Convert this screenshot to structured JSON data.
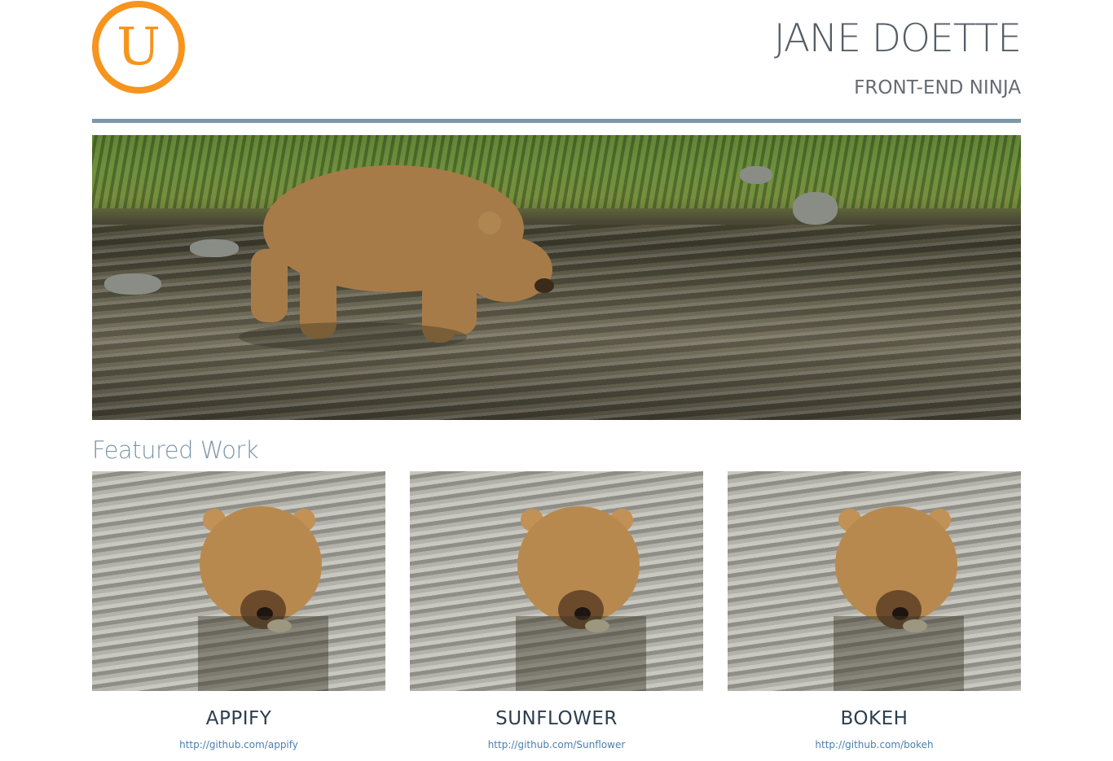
{
  "header": {
    "logo_letter": "U",
    "name": "JANE DOETTE",
    "tagline": "FRONT-END NINJA"
  },
  "colors": {
    "accent_orange": "#f7941d",
    "rule_blue_gray": "#7d96a8",
    "link_blue": "#4a7fb0",
    "title_dark": "#2c3e50"
  },
  "hero": {
    "image": "brown-bear-wading-in-river"
  },
  "featured": {
    "title": "Featured Work",
    "items": [
      {
        "title": "APPIFY",
        "link": "http://github.com/appify",
        "image": "bear-eating-in-water"
      },
      {
        "title": "SUNFLOWER",
        "link": "http://github.com/Sunflower",
        "image": "bear-eating-in-water"
      },
      {
        "title": "BOKEH",
        "link": "http://github.com/bokeh",
        "image": "bear-eating-in-water"
      }
    ]
  }
}
